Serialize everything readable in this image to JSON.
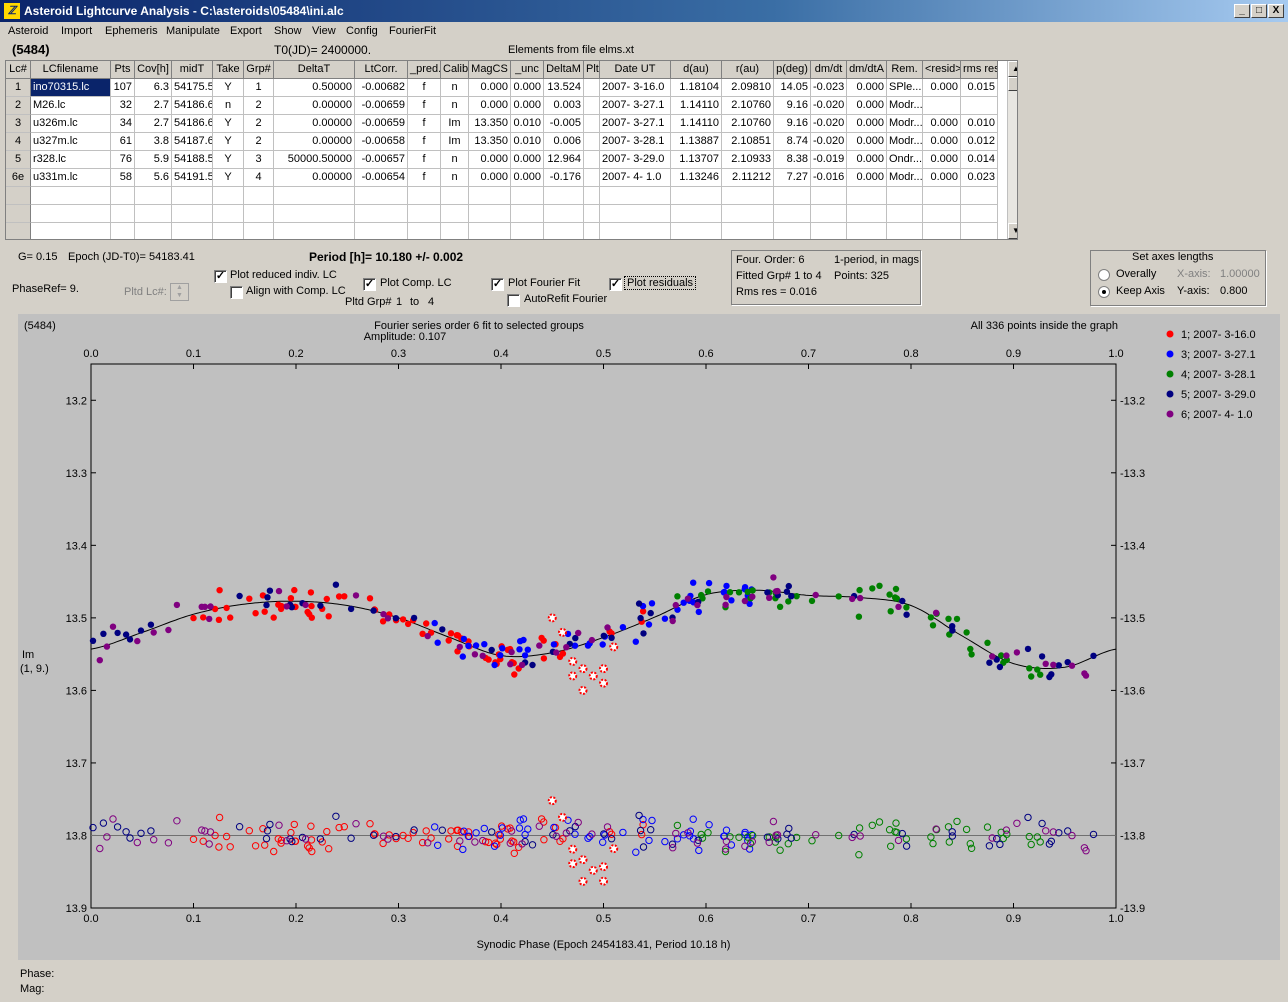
{
  "window": {
    "title": "Asteroid Lightcurve Analysis - C:\\asteroids\\05484\\ini.alc",
    "min_label": "_",
    "max_label": "□",
    "close_label": "X"
  },
  "menu": [
    "Asteroid",
    "Import",
    "Ephemeris",
    "Manipulate",
    "Export",
    "Show",
    "View",
    "Config",
    "FourierFit"
  ],
  "header": {
    "object": "(5484)",
    "t0": "T0(JD)= 2400000.",
    "elements": "Elements from file elms.xt"
  },
  "table": {
    "columns": [
      "Lc#",
      "LCfilename",
      "Pts",
      "Cov[h]",
      "midT",
      "Take",
      "Grp#",
      "DeltaT",
      "LtCorr.",
      "_pred.",
      "Calib.",
      "MagCS",
      "_unc",
      "DeltaM",
      "Plt",
      "Date UT",
      "d(au)",
      "r(au)",
      "p(deg)",
      "dm/dt",
      "dm/dtA",
      "Rem.",
      "<resid>",
      "rms res"
    ],
    "rows": [
      [
        "1",
        "ino70315.lc",
        "107",
        "6.3",
        "54175.5",
        "Y",
        "1",
        "0.50000",
        "-0.00682",
        "f",
        "n",
        "0.000",
        "0.000",
        "13.524",
        "",
        "2007- 3-16.0",
        "1.18104",
        "2.09810",
        "14.05",
        "-0.023",
        "0.000",
        "SPle...",
        "0.000",
        "0.015"
      ],
      [
        "2",
        "M26.lc",
        "32",
        "2.7",
        "54186.6",
        "n",
        "2",
        "0.00000",
        "-0.00659",
        "f",
        "n",
        "0.000",
        "0.000",
        "0.003",
        "",
        "2007- 3-27.1",
        "1.14110",
        "2.10760",
        "9.16",
        "-0.020",
        "0.000",
        "Modr...",
        "",
        ""
      ],
      [
        "3",
        "u326m.lc",
        "34",
        "2.7",
        "54186.6",
        "Y",
        "2",
        "0.00000",
        "-0.00659",
        "f",
        "Im",
        "13.350",
        "0.010",
        "-0.005",
        "",
        "2007- 3-27.1",
        "1.14110",
        "2.10760",
        "9.16",
        "-0.020",
        "0.000",
        "Modr...",
        "0.000",
        "0.010"
      ],
      [
        "4",
        "u327m.lc",
        "61",
        "3.8",
        "54187.6",
        "Y",
        "2",
        "0.00000",
        "-0.00658",
        "f",
        "Im",
        "13.350",
        "0.010",
        "0.006",
        "",
        "2007- 3-28.1",
        "1.13887",
        "2.10851",
        "8.74",
        "-0.020",
        "0.000",
        "Modr...",
        "0.000",
        "0.012"
      ],
      [
        "5",
        "r328.lc",
        "76",
        "5.9",
        "54188.5",
        "Y",
        "3",
        "50000.50000",
        "-0.00657",
        "f",
        "n",
        "0.000",
        "0.000",
        "12.964",
        "",
        "2007- 3-29.0",
        "1.13707",
        "2.10933",
        "8.38",
        "-0.019",
        "0.000",
        "Ondr...",
        "0.000",
        "0.014"
      ],
      [
        "6e",
        "u331m.lc",
        "58",
        "5.6",
        "54191.5",
        "Y",
        "4",
        "0.00000",
        "-0.00654",
        "f",
        "n",
        "0.000",
        "0.000",
        "-0.176",
        "",
        "2007- 4- 1.0",
        "1.13246",
        "2.11212",
        "7.27",
        "-0.016",
        "0.000",
        "Modr...",
        "0.000",
        "0.023"
      ]
    ]
  },
  "controls": {
    "g_label": "G= 0.15",
    "epoch_label": "Epoch (JD-T0)= 54183.41",
    "period_label": "Period [h]= 10.180 +/- 0.002",
    "phaseref_label": "PhaseRef= 9.",
    "pltd_lc_label": "Pltd Lc#:",
    "plot_reduced_label": "Plot reduced indiv. LC",
    "plot_reduced_checked": true,
    "align_label": "Align with Comp. LC",
    "align_checked": false,
    "plot_comp_label": "Plot Comp. LC",
    "plot_comp_checked": true,
    "pltd_grp_label": "Pltd Grp#",
    "pltd_grp_from": "1",
    "pltd_grp_to_label": "to",
    "pltd_grp_to": "4",
    "plot_fourier_label": "Plot Fourier Fit",
    "plot_fourier_checked": true,
    "autorefit_label": "AutoRefit Fourier",
    "autorefit_checked": false,
    "plot_residuals_label": "Plot residuals",
    "plot_residuals_checked": true,
    "check_mark": "✓"
  },
  "fourier_info": {
    "order": "Four. Order:  6",
    "fitted": "Fitted Grp# 1 to 4",
    "rms": "Rms res      = 0.016",
    "mode": "1-period, in mags",
    "points": "Points: 325"
  },
  "axes_panel": {
    "title": "Set axes lengths",
    "overally_label": "Overally",
    "keep_axis_label": "Keep Axis",
    "selected": "Keep Axis",
    "x_axis_label": "X-axis:",
    "x_axis_value": "1.00000",
    "y_axis_label": "Y-axis:",
    "y_axis_value": "0.800"
  },
  "status": {
    "phase_label": "Phase:",
    "mag_label": "Mag:"
  },
  "colors": {
    "group1": "#ff0000",
    "group2": "#0000ff",
    "group3": "#008000",
    "group4": "#000080",
    "group5": "#800080",
    "plot_bg": "#c0c0c0",
    "selection": "#0a246a"
  },
  "chart_data": {
    "type": "scatter",
    "object_label": "(5484)",
    "title": "Fourier series order 6 fit to selected groups",
    "subtitle": "Amplitude: 0.107",
    "note": "All 336 points inside the graph",
    "xlabel": "Synodic Phase (Epoch 2454183.41, Period 10.18 h)",
    "ylabel": "Im",
    "ylabel2": "(1, 9.)",
    "xlim": [
      0,
      1
    ],
    "ylim": [
      13.9,
      13.15
    ],
    "y_inverted": true,
    "xticks": [
      "0.0",
      "0.1",
      "0.2",
      "0.3",
      "0.4",
      "0.5",
      "0.6",
      "0.7",
      "0.8",
      "0.9",
      "1.0"
    ],
    "yticks": [
      "13.2",
      "13.3",
      "13.4",
      "13.5",
      "13.6",
      "13.7",
      "13.8",
      "13.9"
    ],
    "residual_baseline": 13.8,
    "legend": [
      {
        "label": "1; 2007- 3-16.0",
        "color": "#ff0000"
      },
      {
        "label": "3; 2007- 3-27.1",
        "color": "#0000ff"
      },
      {
        "label": "4; 2007- 3-28.1",
        "color": "#008000"
      },
      {
        "label": "5; 2007- 3-29.0",
        "color": "#000080"
      },
      {
        "label": "6; 2007- 4- 1.0",
        "color": "#800080"
      }
    ],
    "fit_curve": {
      "x": [
        0.0,
        0.05,
        0.1,
        0.15,
        0.2,
        0.25,
        0.3,
        0.35,
        0.4,
        0.45,
        0.5,
        0.55,
        0.6,
        0.65,
        0.7,
        0.75,
        0.8,
        0.85,
        0.9,
        0.95,
        1.0
      ],
      "y": [
        13.543,
        13.52,
        13.495,
        13.481,
        13.477,
        13.483,
        13.5,
        13.527,
        13.552,
        13.548,
        13.527,
        13.499,
        13.468,
        13.462,
        13.469,
        13.472,
        13.483,
        13.525,
        13.563,
        13.568,
        13.543
      ]
    },
    "series": [
      {
        "name": "1; 2007- 3-16.0",
        "color": "#ff0000",
        "phase_range": [
          0.08,
          0.55
        ]
      },
      {
        "name": "3; 2007- 3-27.1",
        "color": "#0000ff",
        "phase_range": [
          0.33,
          0.65
        ]
      },
      {
        "name": "4; 2007- 3-28.1",
        "color": "#008000",
        "phase_range": [
          0.57,
          0.93
        ]
      },
      {
        "name": "5; 2007- 3-29.0",
        "color": "#000080",
        "phase_range": [
          0.0,
          1.0
        ]
      },
      {
        "name": "6; 2007- 4- 1.0",
        "color": "#800080",
        "phase_range": [
          0.0,
          1.0
        ]
      }
    ],
    "rejected_points": {
      "color": "#ff0000",
      "x": [
        0.45,
        0.46,
        0.47,
        0.48,
        0.49,
        0.5,
        0.51,
        0.48,
        0.47,
        0.5
      ],
      "y": [
        13.5,
        13.52,
        13.58,
        13.6,
        13.58,
        13.57,
        13.54,
        13.57,
        13.56,
        13.59
      ]
    }
  }
}
